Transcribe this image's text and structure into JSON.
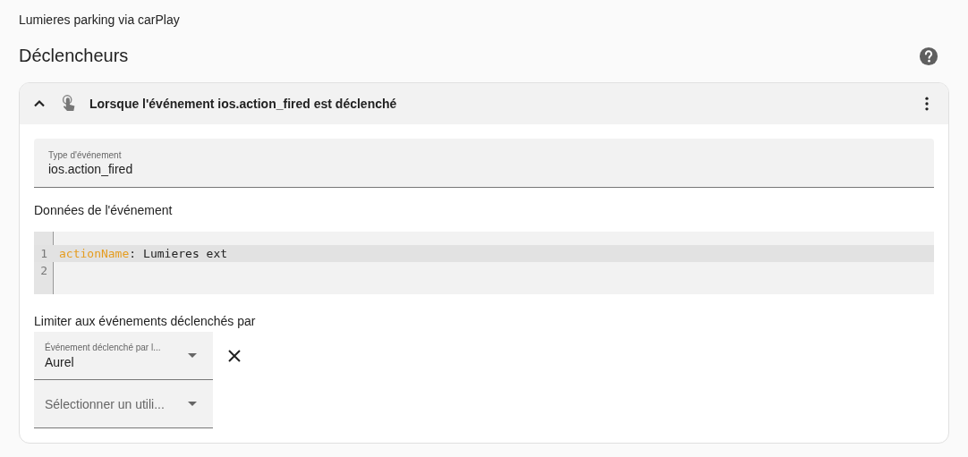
{
  "automation_name": "Lumieres parking via carPlay",
  "section": {
    "title": "Déclencheurs"
  },
  "trigger": {
    "expanded": true,
    "title": "Lorsque l'événement ios.action_fired est déclenché",
    "event_type": {
      "label": "Type d'événement",
      "value": "ios.action_fired"
    },
    "event_data": {
      "label": "Données de l'événement",
      "lines": [
        {
          "number": "1",
          "key": "actionName",
          "separator": ":",
          "value": "Lumieres ext",
          "active": true
        },
        {
          "number": "2",
          "active": false
        }
      ]
    },
    "limit": {
      "label": "Limiter aux événements déclenchés par",
      "users": [
        {
          "label": "Événement déclenché par l...",
          "value": "Aurel",
          "removable": true
        },
        {
          "placeholder": "Sélectionner un utili...",
          "removable": false
        }
      ]
    }
  }
}
